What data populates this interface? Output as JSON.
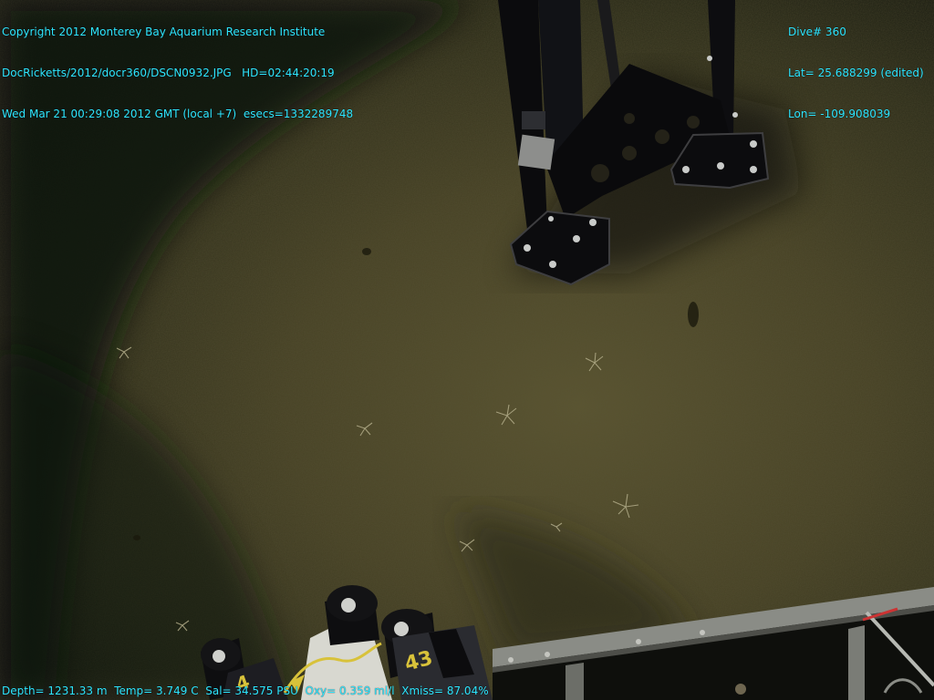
{
  "overlay": {
    "top_left": {
      "line1": "Copyright 2012 Monterey Bay Aquarium Research Institute",
      "line2": "DocRicketts/2012/docr360/DSCN0932.JPG   HD=02:44:20:19",
      "line3": "Wed Mar 21 00:29:08 2012 GMT (local +7)  esecs=1332289748"
    },
    "top_right": {
      "line1": "Dive# 360",
      "line2": "Lat= 25.688299 (edited)",
      "line3": "Lon= -109.908039"
    },
    "bottom": {
      "depth": "Depth= 1231.33 m",
      "temp": "Temp= 3.749 C",
      "sal": "Sal= 34.575 PSU",
      "oxy": "Oxy= 0.359 ml/l",
      "xmiss": "Xmiss= 87.04%"
    },
    "text_color": "#2ee6ff"
  },
  "scene": {
    "description_colors": {
      "sediment": "#4a4526",
      "shadow": "#101411",
      "equipment": "#0b0b0d",
      "rail": "#8a8c86",
      "bottle_label": "#d8c23a"
    },
    "bottle_labels": [
      "43"
    ]
  }
}
